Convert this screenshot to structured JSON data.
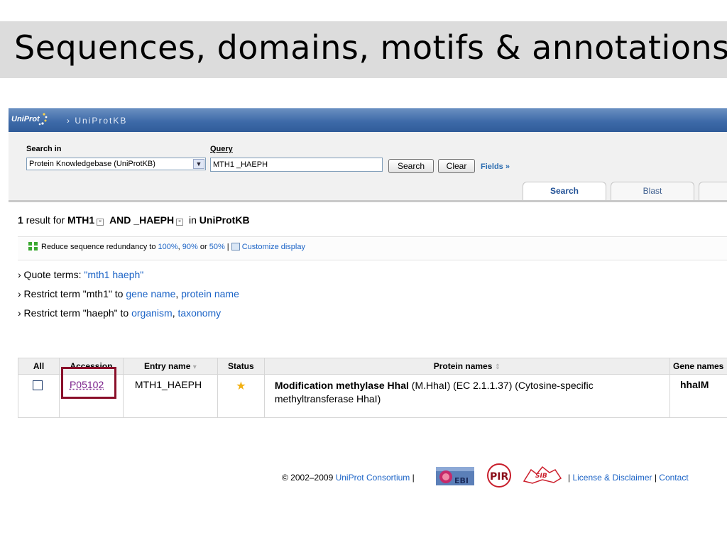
{
  "slide": {
    "title": "Sequences, domains, motifs & annotations"
  },
  "header": {
    "logo": "UniProt",
    "breadcrumb": "› UniProtKB"
  },
  "search": {
    "search_in_label": "Search in",
    "query_label": "Query",
    "database": "Protein Knowledgebase (UniProtKB)",
    "query_value": "MTH1 _HAEPH",
    "search_button": "Search",
    "clear_button": "Clear",
    "fields_link": "Fields »",
    "tabs": [
      "Search",
      "Blast"
    ]
  },
  "results": {
    "count": "1",
    "text_result_for": "result for",
    "term1": "MTH1",
    "operator": "AND",
    "term2": "_HAEPH",
    "text_in": "in",
    "database": "UniProtKB"
  },
  "redundancy": {
    "text": "Reduce sequence redundancy to",
    "opt100": "100%",
    "opt90": "90%",
    "text_or": "or",
    "opt50": "50%",
    "customize": "Customize display"
  },
  "suggestions": {
    "quote_label": "› Quote terms:",
    "quote_link": "\"mth1 haeph\"",
    "restrict1_label": "› Restrict term \"mth1\" to",
    "restrict1_link1": "gene name",
    "restrict1_link2": "protein name",
    "restrict2_label": "› Restrict term \"haeph\" to",
    "restrict2_link1": "organism",
    "restrict2_link2": "taxonomy"
  },
  "table": {
    "columns": [
      "All",
      "Accession",
      "Entry name",
      "Status",
      "Protein names",
      "Gene names"
    ],
    "rows": [
      {
        "accession": "P05102",
        "entry_name": "MTH1_HAEPH",
        "status_icon": "star-icon",
        "protein_bold": "Modification methylase HhaI",
        "protein_rest": "(M.HhaI) (EC 2.1.1.37) (Cytosine-specific methyltransferase HhaI)",
        "gene": "hhaIM"
      }
    ]
  },
  "footer": {
    "copyright": "© 2002–2009",
    "consortium": "UniProt Consortium",
    "license": "License & Disclaimer",
    "contact": "Contact",
    "logos": {
      "ebi": "EBI",
      "pir": "PIR",
      "sib": "SIB"
    }
  },
  "colors": {
    "header_blue": "#3d6aa8",
    "link": "#1b63c6",
    "highlight": "#8a0f2a",
    "star": "#f2b012"
  }
}
